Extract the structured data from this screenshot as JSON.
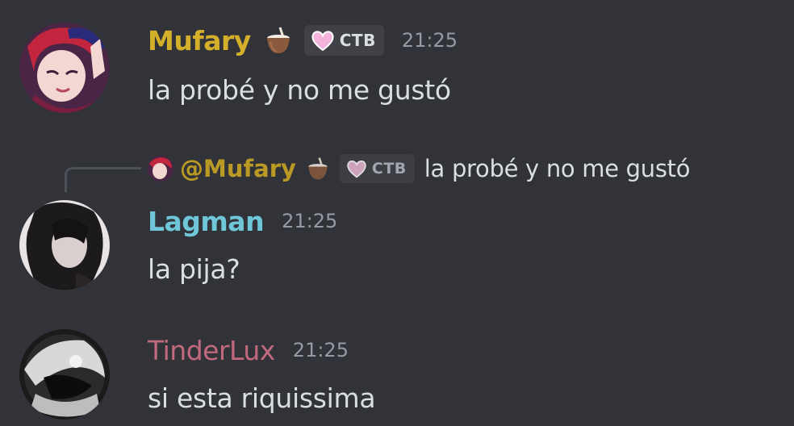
{
  "messages": [
    {
      "username": "Mufary",
      "username_color": "#d4b02a",
      "emoji": "coconut-drink-icon",
      "tag": {
        "label": "CTB",
        "icon": "heart-icon"
      },
      "timestamp": "21:25",
      "text": "la probé y no me gustó"
    },
    {
      "reply": {
        "username": "@Mufary",
        "emoji": "coconut-drink-icon",
        "tag": {
          "label": "CTB",
          "icon": "heart-icon"
        },
        "text": "la probé y no me gustó"
      },
      "username": "Lagman",
      "username_color": "#6ec6d8",
      "timestamp": "21:25",
      "text": "la pija?"
    },
    {
      "username": "TinderLux",
      "username_color": "#c2697e",
      "timestamp": "21:25",
      "text": "si esta riquissima"
    }
  ]
}
